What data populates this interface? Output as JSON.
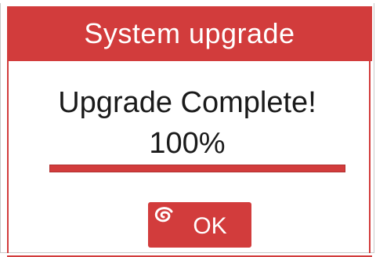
{
  "dialog": {
    "title": "System upgrade",
    "message": "Upgrade Complete!",
    "progress_text": "100%",
    "progress_fraction": 1.0,
    "ok_label": "OK",
    "ok_icon": "swirl-icon"
  },
  "colors": {
    "accent": "#d23c3c",
    "text": "#1a1a1a",
    "background": "#ffffff"
  }
}
